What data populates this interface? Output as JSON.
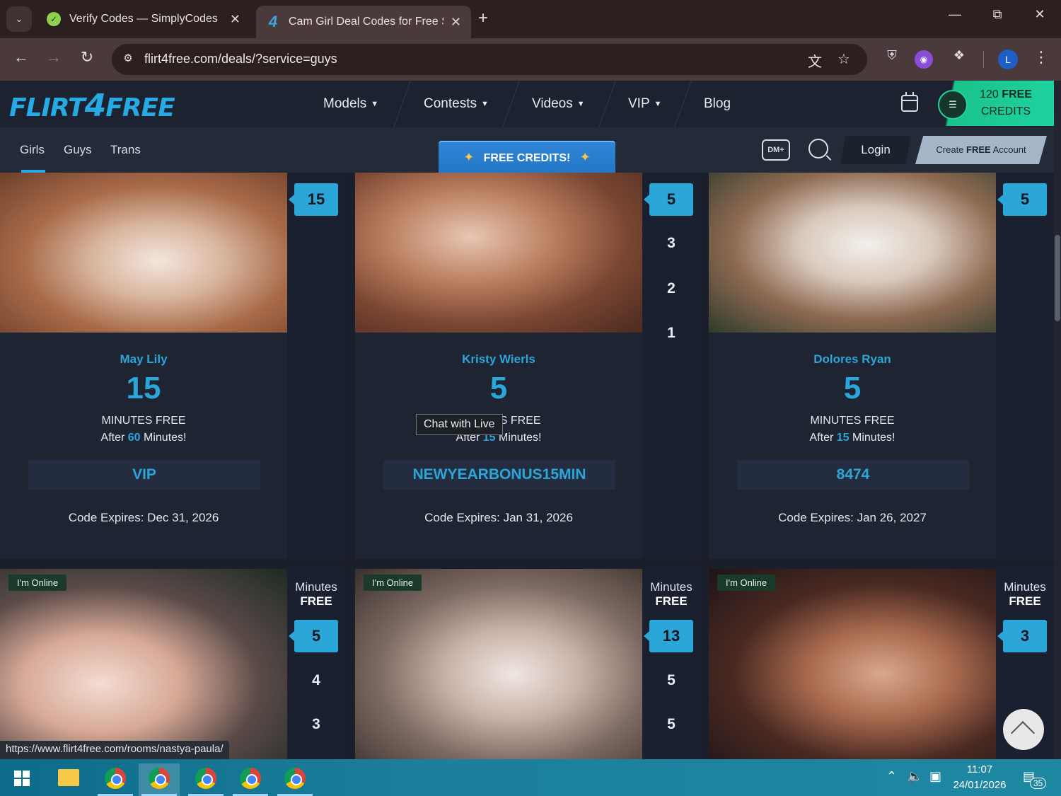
{
  "browser": {
    "tabs": [
      {
        "title": "Verify Codes — SimplyCodes",
        "icon": "simplycodes-icon"
      },
      {
        "title": "Cam Girl Deal Codes for Free Sh",
        "icon": "flirt4free-icon"
      }
    ],
    "url": "flirt4free.com/deals/?service=guys",
    "profile_initial": "L"
  },
  "site": {
    "logo": {
      "left": "FLIRT",
      "four": "4",
      "right": "FREE"
    },
    "nav": [
      "Models",
      "Contests",
      "Videos",
      "VIP",
      "Blog"
    ],
    "credits": {
      "amount": "120",
      "free": "FREE",
      "label": "CREDITS"
    },
    "subtabs": [
      "Girls",
      "Guys",
      "Trans"
    ],
    "free_credits_btn": "FREE CREDITS!",
    "dm_label": "DM+",
    "login": "Login",
    "create_account": {
      "pre": "Create",
      "bold": "FREE",
      "post": "Account"
    }
  },
  "cards_row1": [
    {
      "name": "May Lily",
      "minutes": "15",
      "mf": "MINUTES FREE",
      "after_pre": "After",
      "after_num": "60",
      "after_post": "Minutes!",
      "code": "VIP",
      "expires": "Code Expires: Dec 31, 2026",
      "side_badge": "15",
      "side_nums": []
    },
    {
      "name": "Kristy Wierls",
      "minutes": "5",
      "mf": "MINUTES FREE",
      "after_pre": "After",
      "after_num": "15",
      "after_post": "Minutes!",
      "code": "NEWYEARBONUS15MIN",
      "expires": "Code Expires: Jan 31, 2026",
      "side_badge": "5",
      "side_nums": [
        "3",
        "2",
        "1"
      ]
    },
    {
      "name": "Dolores Ryan",
      "minutes": "5",
      "mf": "MINUTES FREE",
      "after_pre": "After",
      "after_num": "15",
      "after_post": "Minutes!",
      "code": "8474",
      "expires": "Code Expires: Jan 26, 2027",
      "side_badge": "5",
      "side_nums": []
    }
  ],
  "cards_row2": [
    {
      "online": "I'm Online",
      "side_label": "Minutes",
      "side_free": "FREE",
      "side_badge": "5",
      "side_nums": [
        "4",
        "3"
      ]
    },
    {
      "online": "I'm Online",
      "side_label": "Minutes",
      "side_free": "FREE",
      "side_badge": "13",
      "side_nums": [
        "5",
        "5"
      ]
    },
    {
      "online": "I'm Online",
      "side_label": "Minutes",
      "side_free": "FREE",
      "side_badge": "3",
      "side_nums": []
    }
  ],
  "tooltip": "Chat with  Live",
  "status_url": "https://www.flirt4free.com/rooms/nastya-paula/",
  "taskbar": {
    "time": "11:07",
    "date": "24/01/2026",
    "notifications": "35"
  }
}
